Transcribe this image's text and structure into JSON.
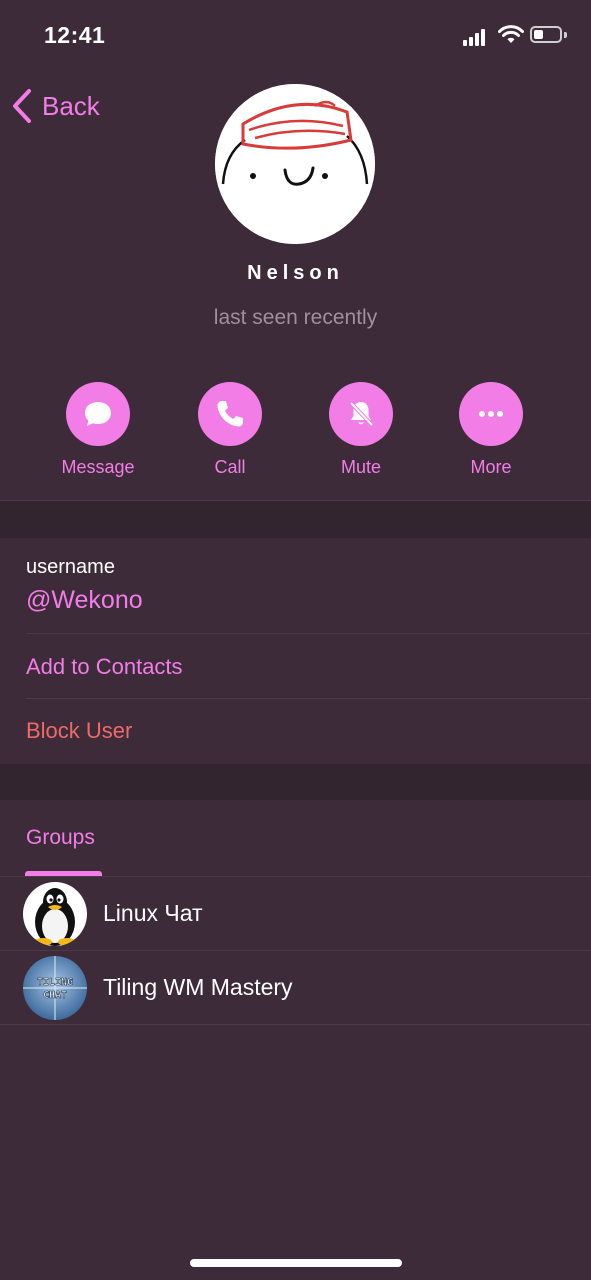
{
  "status_bar": {
    "time": "12:41"
  },
  "nav": {
    "back_label": "Back"
  },
  "profile": {
    "name": "Nelson",
    "status": "last seen recently"
  },
  "actions": [
    {
      "label": "Message",
      "icon": "message-bubble-icon"
    },
    {
      "label": "Call",
      "icon": "phone-icon"
    },
    {
      "label": "Mute",
      "icon": "bell-slash-icon"
    },
    {
      "label": "More",
      "icon": "ellipsis-icon"
    }
  ],
  "info": {
    "username_label": "username",
    "username_value": "@Wekono",
    "add_contact": "Add to Contacts",
    "block_user": "Block User"
  },
  "tabs": {
    "groups": "Groups"
  },
  "groups": [
    {
      "name": "Linux Чат",
      "avatar": "tux-penguin"
    },
    {
      "name": "Tiling WM Mastery",
      "avatar": "tiling-chat-badge",
      "avatar_text": "TILING CHAT"
    }
  ],
  "colors": {
    "accent": "#f27de6",
    "background": "#3d2b39",
    "separator": "#33252f",
    "destructive": "#ee6a6a",
    "secondary_text": "#a08f9c"
  }
}
